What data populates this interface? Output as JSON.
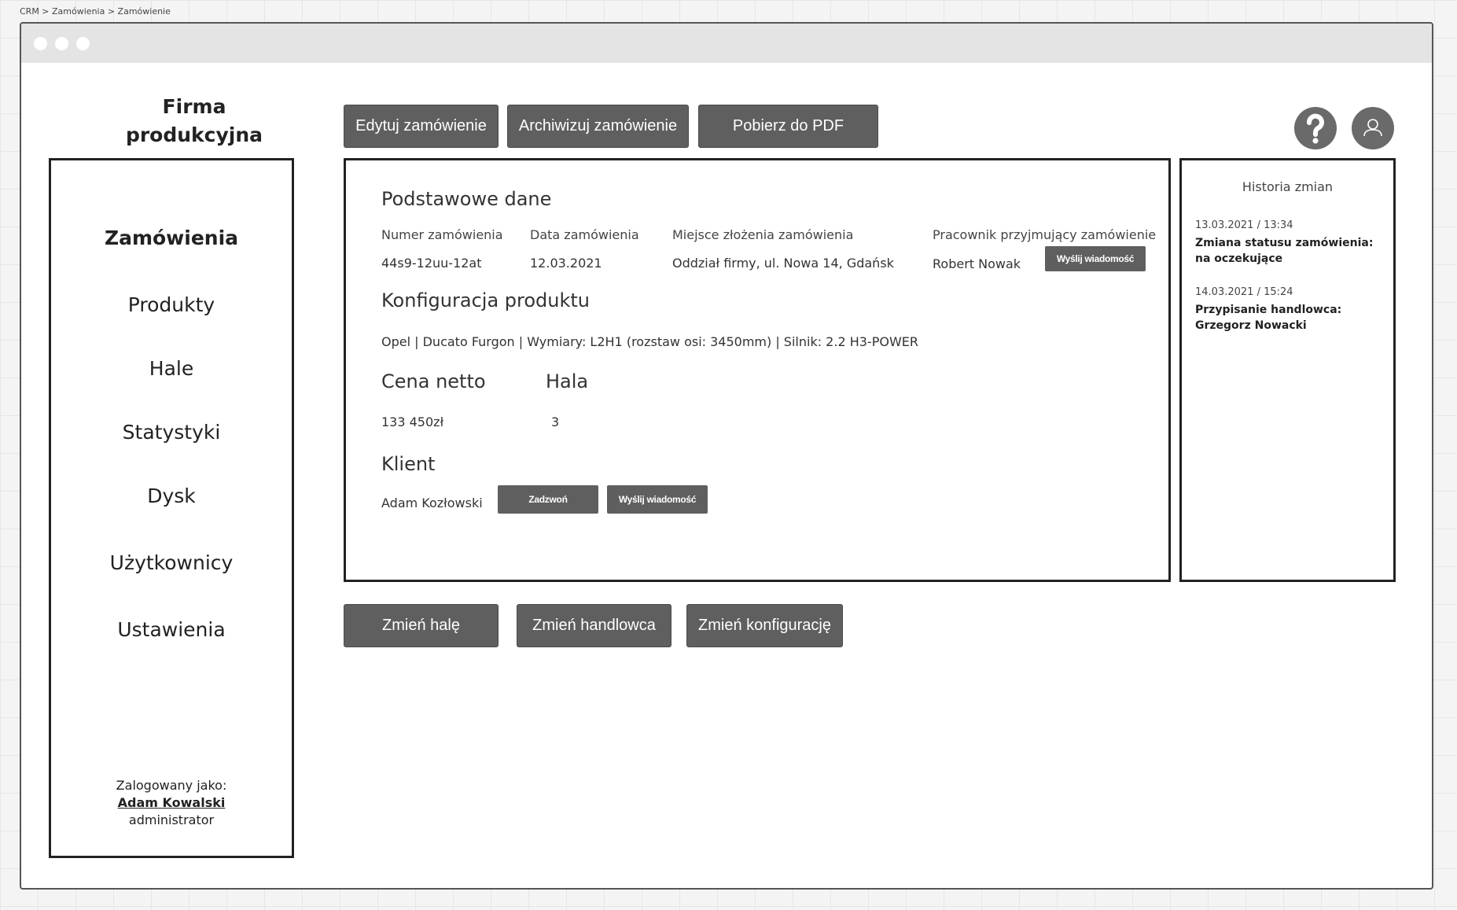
{
  "breadcrumb": "CRM > Zamówienia > Zamówienie",
  "company": {
    "line1": "Firma",
    "line2": "produkcyjna"
  },
  "toolbar": {
    "edit_label": "Edytuj zamówienie",
    "archive_label": "Archiwizuj zamówienie",
    "pdf_label": "Pobierz do PDF"
  },
  "header_icons": {
    "help": "help-icon",
    "user": "user-icon"
  },
  "sidebar": {
    "items": [
      {
        "label": "Zamówienia",
        "active": true
      },
      {
        "label": "Produkty",
        "active": false
      },
      {
        "label": "Hale",
        "active": false
      },
      {
        "label": "Statystyki",
        "active": false
      },
      {
        "label": "Dysk",
        "active": false
      },
      {
        "label": "Użytkownicy",
        "active": false
      },
      {
        "label": "Ustawienia",
        "active": false
      }
    ],
    "login": {
      "prefix": "Zalogowany jako:",
      "name": "Adam Kowalski",
      "role": "administrator"
    }
  },
  "order": {
    "basic_title": "Podstawowe dane",
    "number_label": "Numer zamówienia",
    "number_value": "44s9-12uu-12at",
    "date_label": "Data zamówienia",
    "date_value": "12.03.2021",
    "place_label": "Miejsce złożenia zamówienia",
    "place_value": "Oddział firmy, ul. Nowa 14, Gdańsk",
    "employee_label": "Pracownik przyjmujący zamówienie",
    "employee_value": "Robert Nowak",
    "employee_message_label": "Wyślij wiadomość",
    "config_title": "Konfiguracja produktu",
    "config_value": "Opel | Ducato Furgon | Wymiary: L2H1 (rozstaw osi: 3450mm) | Silnik: 2.2 H3-POWER",
    "price_title": "Cena netto",
    "price_value": "133 450zł",
    "hall_title": "Hala",
    "hall_value": "3",
    "client_title": "Klient",
    "client_value": "Adam Kozłowski",
    "call_label": "Zadzwoń",
    "client_message_label": "Wyślij wiadomość"
  },
  "history": {
    "title": "Historia zmian",
    "entries": [
      {
        "date": "13.03.2021 / 13:34",
        "text": "Zmiana statusu zamówienia: na oczekujące"
      },
      {
        "date": "14.03.2021 / 15:24",
        "text": "Przypisanie handlowca: Grzegorz Nowacki"
      }
    ]
  },
  "actions": {
    "change_hall": "Zmień halę",
    "change_sales": "Zmień handlowca",
    "change_config": "Zmień konfigurację"
  }
}
